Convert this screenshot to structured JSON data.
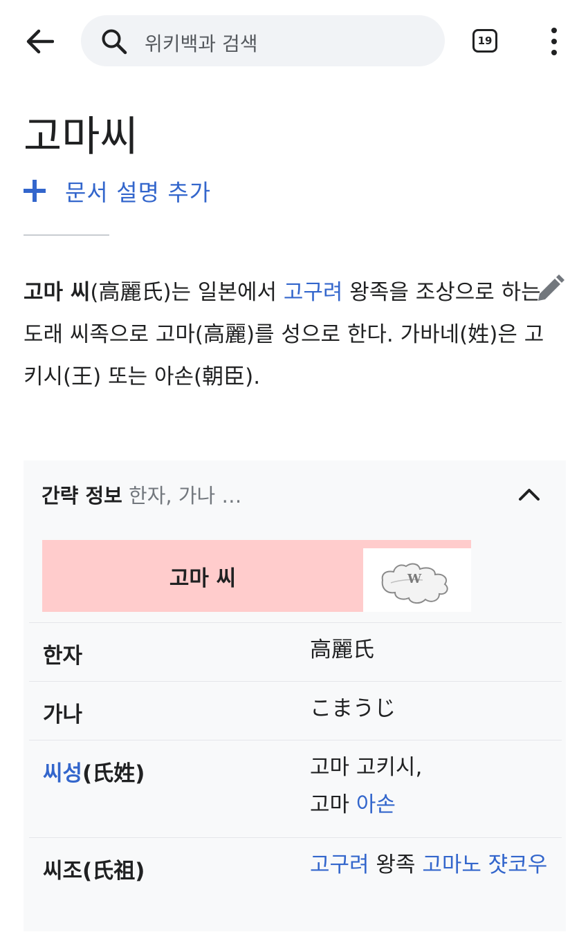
{
  "topbar": {
    "search_placeholder": "위키백과 검색",
    "tabs_count": "19",
    "icons": [
      "back-arrow-icon",
      "search-icon",
      "tabs-icon",
      "overflow-menu-icon"
    ]
  },
  "article": {
    "title": "고마씨",
    "add_description": "문서 설명 추가",
    "lead": {
      "bold_name": "고마 씨",
      "t1": "(高麗氏)는 일본에서 ",
      "link1": "고구려",
      "t2": " 왕족을 조상으로 하는 도래 씨족으로 고마(高麗)를 성으로 한다. 가바네(姓)은 고키시(王) 또는 아손(朝臣)."
    }
  },
  "infobox": {
    "header_bold": "간략 정보",
    "header_sub": " 한자, 가나 …",
    "banner_title": "고마 씨",
    "banner_color": "#ffcccc",
    "puzzle_letter": "W",
    "rows": [
      {
        "key": "한자",
        "value": "高麗氏"
      },
      {
        "key": "가나",
        "value": "こまうじ"
      },
      {
        "key_link": "씨성",
        "key_rest": "(氏姓)",
        "value_line1": "고마 고키시,",
        "value_line2_text": "고마 ",
        "value_line2_link": "아손"
      },
      {
        "key": "씨조(氏祖)",
        "v_link1": "고구려",
        "v_text": " 왕족 ",
        "v_link2": "고마노 쟛코우"
      }
    ]
  },
  "colors": {
    "link": "#3366cc",
    "text": "#202122",
    "infobox_bg": "#f8f9fa"
  }
}
